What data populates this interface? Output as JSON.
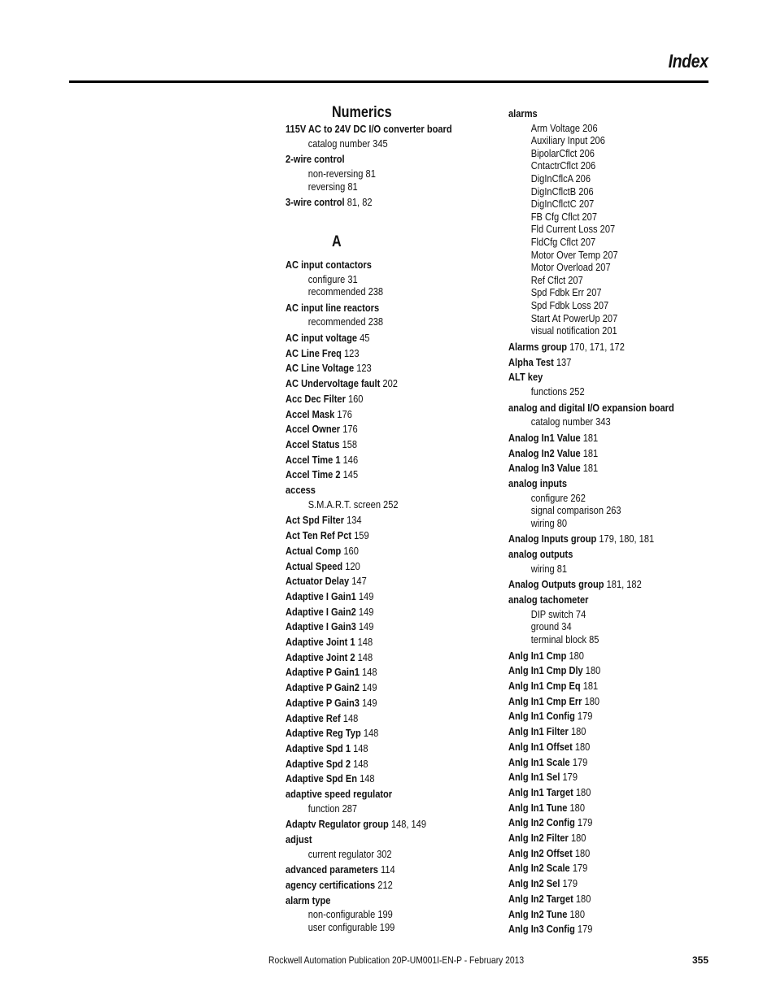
{
  "header": {
    "title": "Index"
  },
  "footer": {
    "publication": "Rockwell Automation Publication 20P-UM001I-EN-P - February 2013",
    "page_number": "355"
  },
  "left_column": {
    "numerics_heading": "Numerics",
    "numerics": [
      {
        "term": "115V AC to 24V DC I/O converter board",
        "pages": "",
        "subs": [
          "catalog number 345"
        ]
      },
      {
        "term": "2-wire control",
        "pages": "",
        "subs": [
          "non-reversing 81",
          "reversing 81"
        ]
      },
      {
        "term": "3-wire control",
        "pages": "81, 82",
        "subs": []
      }
    ],
    "a_heading": "A",
    "a_entries": [
      {
        "term": "AC input contactors",
        "pages": "",
        "subs": [
          "configure 31",
          "recommended 238"
        ]
      },
      {
        "term": "AC input line reactors",
        "pages": "",
        "subs": [
          "recommended 238"
        ]
      },
      {
        "term": "AC input voltage",
        "pages": "45",
        "subs": []
      },
      {
        "term": "AC Line Freq",
        "pages": "123",
        "subs": []
      },
      {
        "term": "AC Line Voltage",
        "pages": "123",
        "subs": []
      },
      {
        "term": "AC Undervoltage fault",
        "pages": "202",
        "subs": []
      },
      {
        "term": "Acc Dec Filter",
        "pages": "160",
        "subs": []
      },
      {
        "term": "Accel Mask",
        "pages": "176",
        "subs": []
      },
      {
        "term": "Accel Owner",
        "pages": "176",
        "subs": []
      },
      {
        "term": "Accel Status",
        "pages": "158",
        "subs": []
      },
      {
        "term": "Accel Time 1",
        "pages": "146",
        "subs": []
      },
      {
        "term": "Accel Time 2",
        "pages": "145",
        "subs": []
      },
      {
        "term": "access",
        "pages": "",
        "subs": [
          "S.M.A.R.T. screen 252"
        ]
      },
      {
        "term": "Act Spd Filter",
        "pages": "134",
        "subs": []
      },
      {
        "term": "Act Ten Ref Pct",
        "pages": "159",
        "subs": []
      },
      {
        "term": "Actual Comp",
        "pages": "160",
        "subs": []
      },
      {
        "term": "Actual Speed",
        "pages": "120",
        "subs": []
      },
      {
        "term": "Actuator Delay",
        "pages": "147",
        "subs": []
      },
      {
        "term": "Adaptive I Gain1",
        "pages": "149",
        "subs": []
      },
      {
        "term": "Adaptive I Gain2",
        "pages": "149",
        "subs": []
      },
      {
        "term": "Adaptive I Gain3",
        "pages": "149",
        "subs": []
      },
      {
        "term": "Adaptive Joint 1",
        "pages": "148",
        "subs": []
      },
      {
        "term": "Adaptive Joint 2",
        "pages": "148",
        "subs": []
      },
      {
        "term": "Adaptive P Gain1",
        "pages": "148",
        "subs": []
      },
      {
        "term": "Adaptive P Gain2",
        "pages": "149",
        "subs": []
      },
      {
        "term": "Adaptive P Gain3",
        "pages": "149",
        "subs": []
      },
      {
        "term": "Adaptive Ref",
        "pages": "148",
        "subs": []
      },
      {
        "term": "Adaptive Reg Typ",
        "pages": "148",
        "subs": []
      },
      {
        "term": "Adaptive Spd 1",
        "pages": "148",
        "subs": []
      },
      {
        "term": "Adaptive Spd 2",
        "pages": "148",
        "subs": []
      },
      {
        "term": "Adaptive Spd En",
        "pages": "148",
        "subs": []
      },
      {
        "term": "adaptive speed regulator",
        "pages": "",
        "subs": [
          "function 287"
        ]
      },
      {
        "term": "Adaptv Regulator group",
        "pages": "148, 149",
        "subs": []
      },
      {
        "term": "adjust",
        "pages": "",
        "subs": [
          "current regulator 302"
        ]
      },
      {
        "term": "advanced parameters",
        "pages": "114",
        "subs": []
      },
      {
        "term": "agency certifications",
        "pages": "212",
        "subs": []
      },
      {
        "term": "alarm type",
        "pages": "",
        "subs": [
          "non-configurable 199",
          "user configurable 199"
        ]
      }
    ]
  },
  "right_column": {
    "entries": [
      {
        "term": "alarms",
        "pages": "",
        "subs": [
          "Arm Voltage 206",
          "Auxiliary Input 206",
          "BipolarCflct 206",
          "CntactrCflct 206",
          "DigInCflcA 206",
          "DigInCflctB 206",
          "DigInCflctC 207",
          "FB Cfg Cflct 207",
          "Fld Current Loss 207",
          "FldCfg Cflct 207",
          "Motor Over Temp 207",
          "Motor Overload 207",
          "Ref Cflct 207",
          "Spd Fdbk Err 207",
          "Spd Fdbk Loss 207",
          "Start At PowerUp 207",
          "visual notification 201"
        ]
      },
      {
        "term": "Alarms group",
        "pages": "170, 171, 172",
        "subs": []
      },
      {
        "term": "Alpha Test",
        "pages": "137",
        "subs": []
      },
      {
        "term": "ALT key",
        "pages": "",
        "subs": [
          "functions 252"
        ]
      },
      {
        "term": "analog and digital I/O expansion board",
        "pages": "",
        "subs": [
          "catalog number 343"
        ]
      },
      {
        "term": "Analog In1 Value",
        "pages": "181",
        "subs": []
      },
      {
        "term": "Analog In2 Value",
        "pages": "181",
        "subs": []
      },
      {
        "term": "Analog In3 Value",
        "pages": "181",
        "subs": []
      },
      {
        "term": "analog inputs",
        "pages": "",
        "subs": [
          "configure 262",
          "signal comparison 263",
          "wiring 80"
        ]
      },
      {
        "term": "Analog Inputs group",
        "pages": "179, 180, 181",
        "subs": []
      },
      {
        "term": "analog outputs",
        "pages": "",
        "subs": [
          "wiring 81"
        ]
      },
      {
        "term": "Analog Outputs group",
        "pages": "181, 182",
        "subs": []
      },
      {
        "term": "analog tachometer",
        "pages": "",
        "subs": [
          "DIP switch 74",
          "ground 34",
          "terminal block 85"
        ]
      },
      {
        "term": "Anlg In1 Cmp",
        "pages": "180",
        "subs": []
      },
      {
        "term": "Anlg In1 Cmp Dly",
        "pages": "180",
        "subs": []
      },
      {
        "term": "Anlg In1 Cmp Eq",
        "pages": "181",
        "subs": []
      },
      {
        "term": "Anlg In1 Cmp Err",
        "pages": "180",
        "subs": []
      },
      {
        "term": "Anlg In1 Config",
        "pages": "179",
        "subs": []
      },
      {
        "term": "Anlg In1 Filter",
        "pages": "180",
        "subs": []
      },
      {
        "term": "Anlg In1 Offset",
        "pages": "180",
        "subs": []
      },
      {
        "term": "Anlg In1 Scale",
        "pages": "179",
        "subs": []
      },
      {
        "term": "Anlg In1 Sel",
        "pages": "179",
        "subs": []
      },
      {
        "term": "Anlg In1 Target",
        "pages": "180",
        "subs": []
      },
      {
        "term": "Anlg In1 Tune",
        "pages": "180",
        "subs": []
      },
      {
        "term": "Anlg In2 Config",
        "pages": "179",
        "subs": []
      },
      {
        "term": "Anlg In2 Filter",
        "pages": "180",
        "subs": []
      },
      {
        "term": "Anlg In2 Offset",
        "pages": "180",
        "subs": []
      },
      {
        "term": "Anlg In2 Scale",
        "pages": "179",
        "subs": []
      },
      {
        "term": "Anlg In2 Sel",
        "pages": "179",
        "subs": []
      },
      {
        "term": "Anlg In2 Target",
        "pages": "180",
        "subs": []
      },
      {
        "term": "Anlg In2 Tune",
        "pages": "180",
        "subs": []
      },
      {
        "term": "Anlg In3 Config",
        "pages": "179",
        "subs": []
      }
    ]
  }
}
